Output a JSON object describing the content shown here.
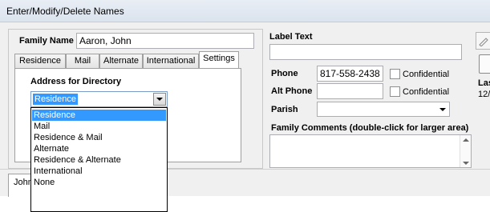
{
  "window": {
    "title": "Enter/Modify/Delete Names"
  },
  "family": {
    "label": "Family Name",
    "value": "Aaron, John"
  },
  "tabs": [
    {
      "label": "Residence"
    },
    {
      "label": "Mail"
    },
    {
      "label": "Alternate"
    },
    {
      "label": "International"
    },
    {
      "label": "Settings"
    }
  ],
  "active_tab": "Settings",
  "directory": {
    "heading": "Address for Directory",
    "selected": "Residence",
    "options": [
      "Residence",
      "Mail",
      "Residence & Mail",
      "Alternate",
      "Residence & Alternate",
      "International",
      "None"
    ]
  },
  "label_text": {
    "label": "Label Text",
    "value": ""
  },
  "phone": {
    "label": "Phone",
    "value": "817-558-2438",
    "confidential_label": "Confidential"
  },
  "alt_phone": {
    "label": "Alt Phone",
    "value": "",
    "confidential_label": "Confidential"
  },
  "parish": {
    "label": "Parish",
    "value": ""
  },
  "comments": {
    "label": "Family Comments  (double-click for larger area)",
    "value": ""
  },
  "right_clipped": {
    "line1": "Las",
    "line2": "12/"
  },
  "bottom_tab": {
    "label": "John"
  }
}
